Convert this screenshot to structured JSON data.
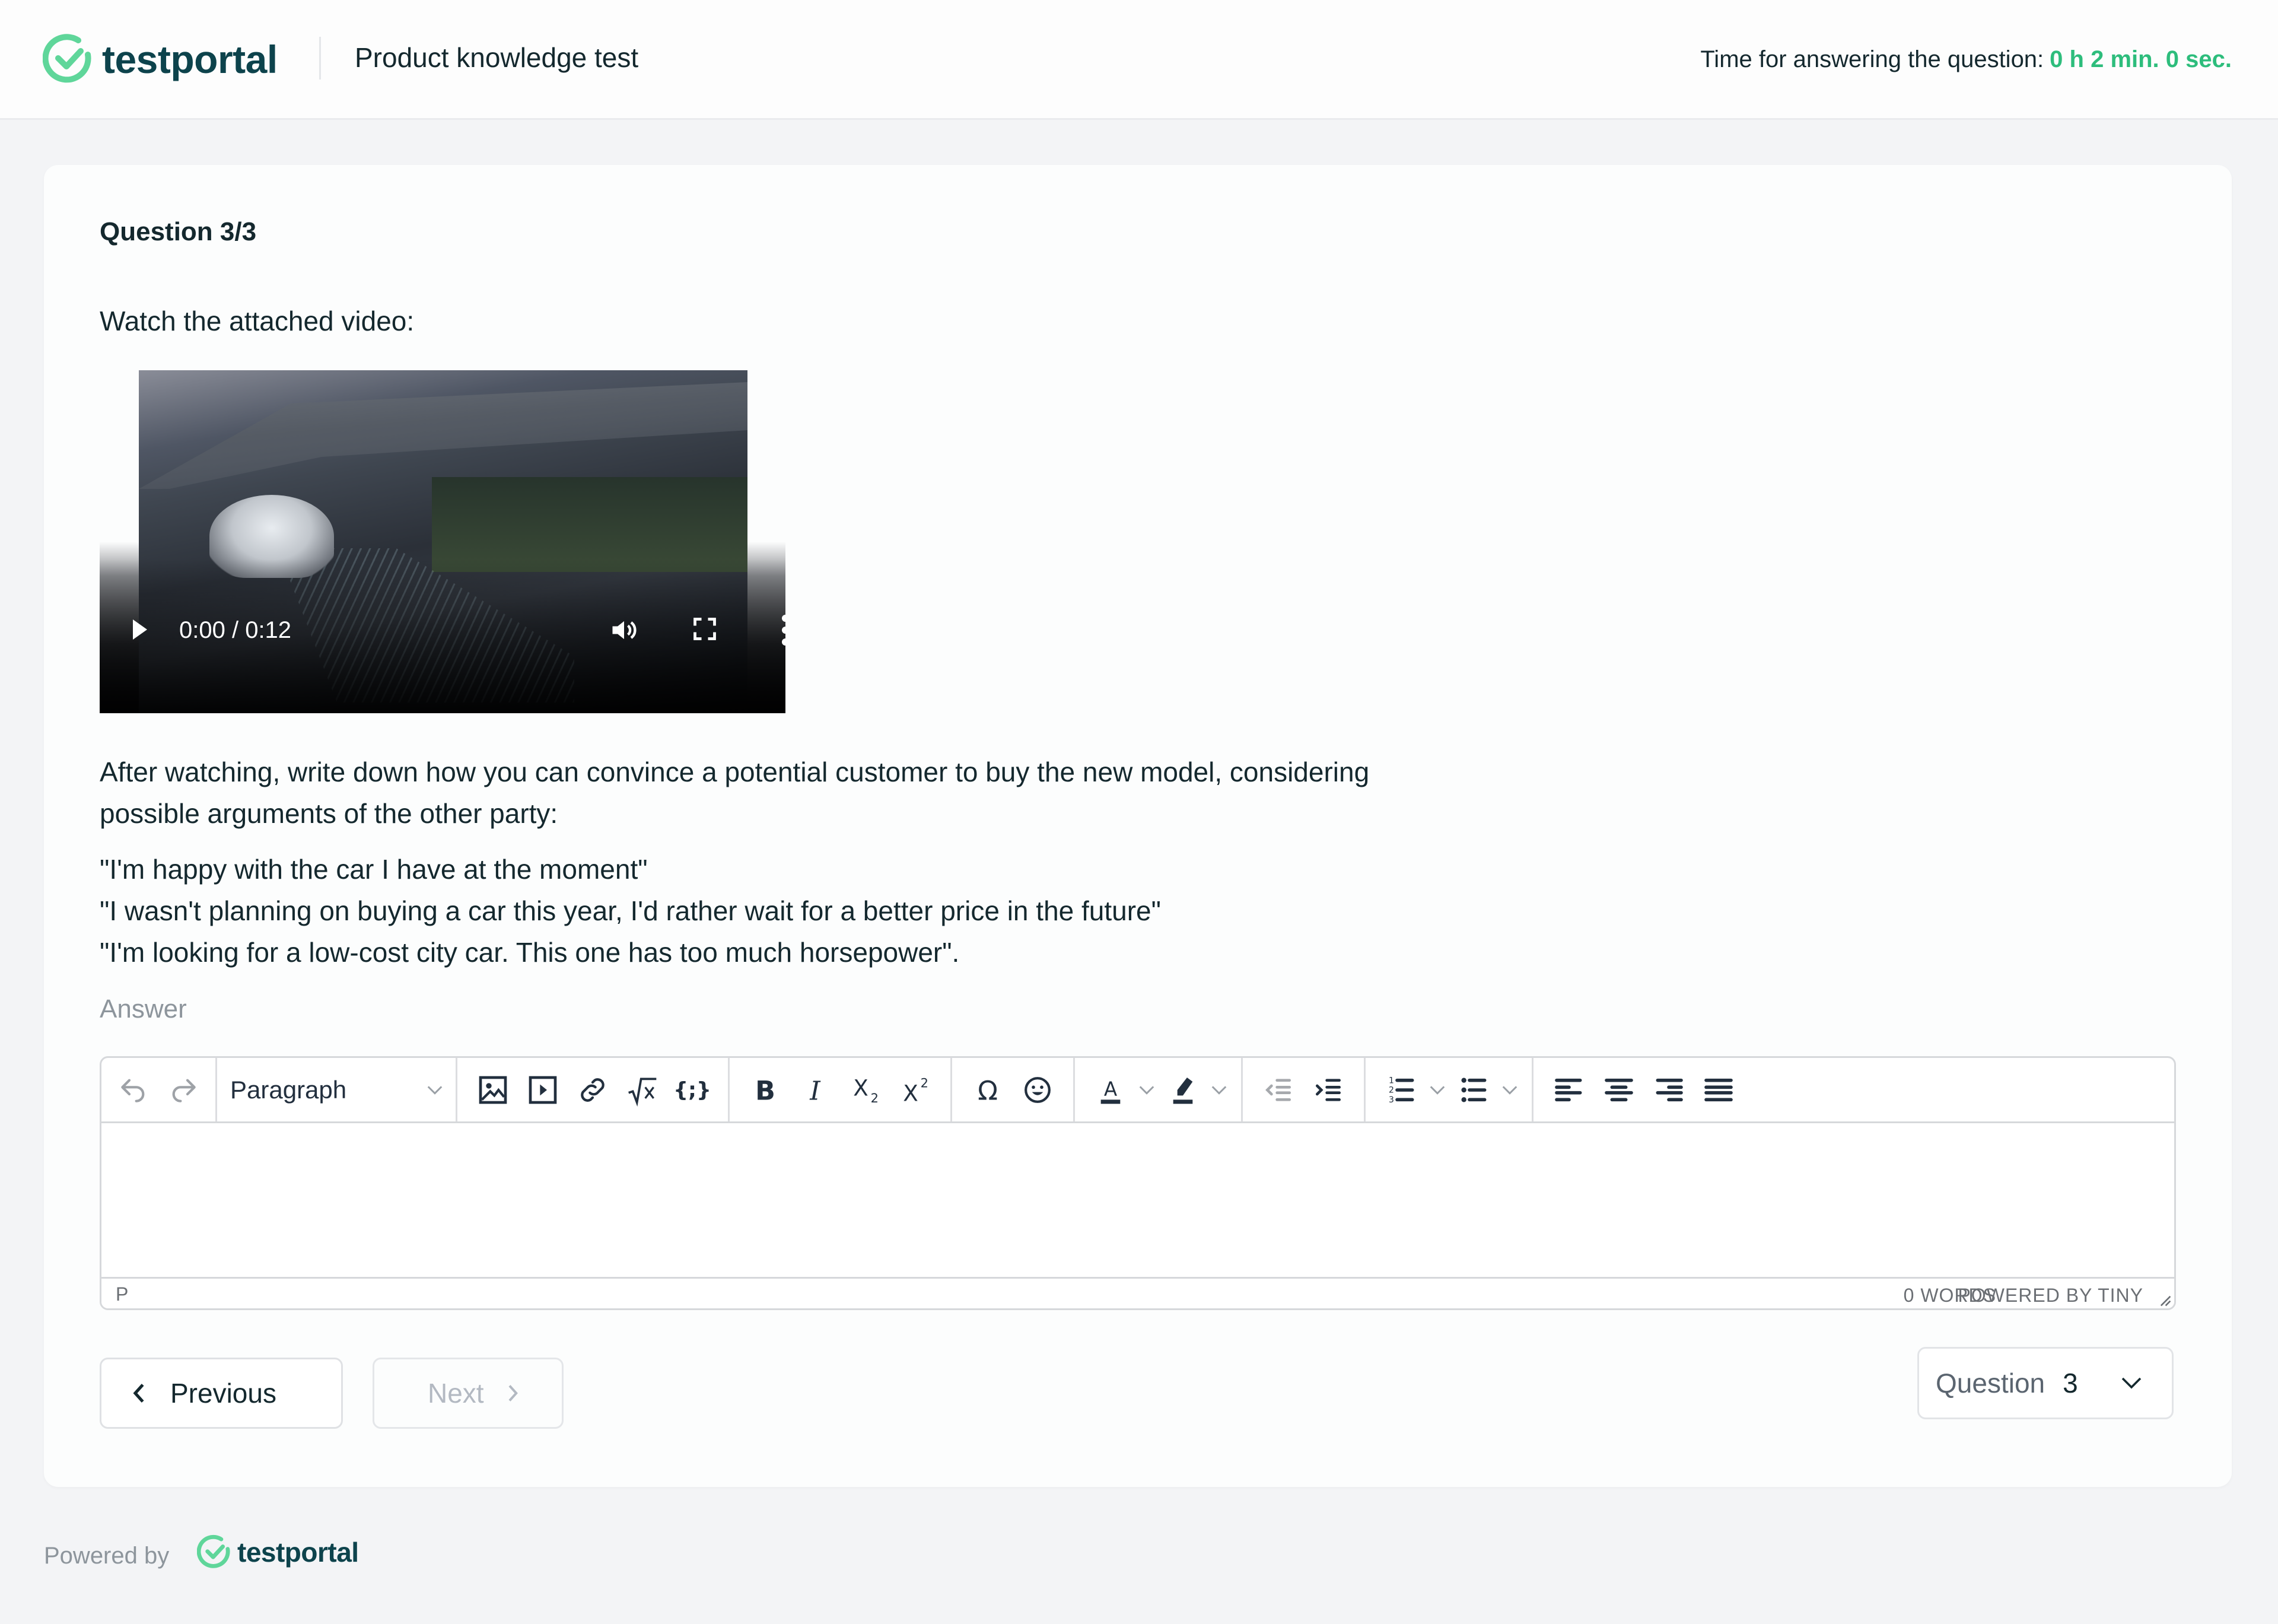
{
  "header": {
    "brand": "testportal",
    "test_title": "Product knowledge test",
    "timer_label": "Time for answering the question:",
    "timer_value": "0 h 2 min. 0 sec."
  },
  "question": {
    "number_label": "Question 3/3",
    "intro": "Watch the attached video:",
    "video": {
      "current_time": "0:00",
      "duration": "0:12",
      "time_display": "0:00 / 0:12",
      "buffered_fraction": 0.24
    },
    "prompt": "After watching, write down how you can convince a potential customer to buy the new model, considering possible arguments of the other party:",
    "quotes": [
      "\"I'm happy with the car I have at the moment\"",
      "\"I wasn't planning on buying a car this year, I'd rather wait for a better price in the future\"",
      "\"I'm looking for a low-cost city car. This one has too much horsepower\"."
    ]
  },
  "answer": {
    "label": "Answer",
    "editor": {
      "block_format": "Paragraph",
      "content": "",
      "status_path": "P",
      "word_count": "0 WORDS",
      "branding": "POWERED BY TINY",
      "toolbar_icons": [
        "undo-icon",
        "redo-icon",
        "image-icon",
        "media-icon",
        "link-icon",
        "math-icon",
        "code-sample-icon",
        "bold-icon",
        "italic-icon",
        "subscript-icon",
        "superscript-icon",
        "special-char-icon",
        "emoji-icon",
        "text-color-icon",
        "highlight-icon",
        "outdent-icon",
        "indent-icon",
        "numbered-list-icon",
        "bullet-list-icon",
        "align-left-icon",
        "align-center-icon",
        "align-right-icon",
        "align-justify-icon"
      ]
    }
  },
  "navigation": {
    "previous_label": "Previous",
    "next_label": "Next",
    "question_select_label": "Question",
    "question_select_value": "3"
  },
  "footer": {
    "powered_by": "Powered by",
    "brand": "testportal"
  },
  "colors": {
    "brand_green": "#5fd69a",
    "brand_dark": "#0d434c",
    "timer_green": "#2dbd7c",
    "text_primary": "#14282e",
    "text_muted": "#8d959c"
  }
}
